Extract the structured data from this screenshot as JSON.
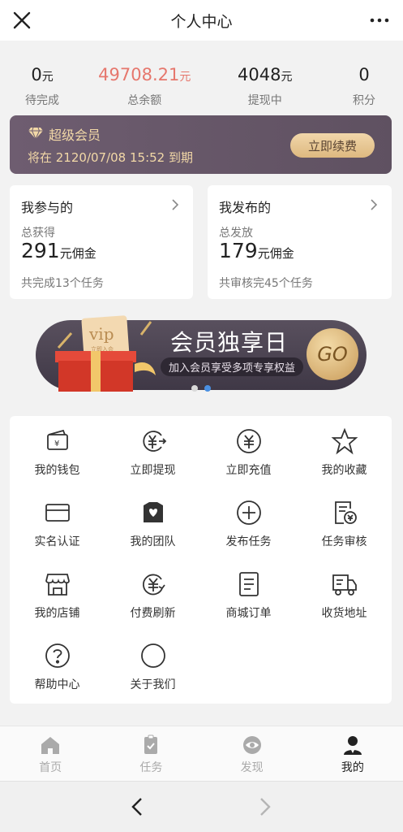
{
  "header": {
    "title": "个人中心",
    "close_icon": "close-icon",
    "more_icon": "more-icon"
  },
  "stats": [
    {
      "value": "0",
      "unit": "元",
      "label": "待完成"
    },
    {
      "value": "49708.21",
      "unit": "元",
      "label": "总余额",
      "color": "#e6776d"
    },
    {
      "value": "4048",
      "unit": "元",
      "label": "提现中"
    },
    {
      "value": "0",
      "unit": "",
      "label": "积分"
    }
  ],
  "vip": {
    "title": "超级会员",
    "expire_text": "将在 2120/07/08 15:52 到期",
    "renew_label": "立即续费",
    "icon": "diamond-icon"
  },
  "participated": {
    "title": "我参与的",
    "sub": "总获得",
    "amount": "291",
    "suffix": "元佣金",
    "footer": "共完成13个任务"
  },
  "published": {
    "title": "我发布的",
    "sub": "总发放",
    "amount": "179",
    "suffix": "元佣金",
    "footer": "共审核完45个任务"
  },
  "banner": {
    "vip_text": "vip",
    "vip_sub": "立即入会",
    "headline": "会员独享日",
    "tagline": "加入会员享受多项专享权益",
    "go_label": "GO"
  },
  "menu": [
    {
      "label": "我的钱包",
      "icon": "wallet-icon"
    },
    {
      "label": "立即提现",
      "icon": "withdraw-icon"
    },
    {
      "label": "立即充值",
      "icon": "recharge-icon"
    },
    {
      "label": "我的收藏",
      "icon": "star-icon"
    },
    {
      "label": "实名认证",
      "icon": "id-card-icon"
    },
    {
      "label": "我的团队",
      "icon": "team-icon"
    },
    {
      "label": "发布任务",
      "icon": "plus-circle-icon"
    },
    {
      "label": "任务审核",
      "icon": "audit-icon"
    },
    {
      "label": "我的店铺",
      "icon": "shop-icon"
    },
    {
      "label": "付费刷新",
      "icon": "refresh-pay-icon"
    },
    {
      "label": "商城订单",
      "icon": "order-icon"
    },
    {
      "label": "收货地址",
      "icon": "truck-icon"
    },
    {
      "label": "帮助中心",
      "icon": "help-icon"
    },
    {
      "label": "关于我们",
      "icon": "about-icon"
    }
  ],
  "tabs": [
    {
      "label": "首页",
      "icon": "home-icon"
    },
    {
      "label": "任务",
      "icon": "task-icon"
    },
    {
      "label": "发现",
      "icon": "eye-icon"
    },
    {
      "label": "我的",
      "icon": "user-icon",
      "active": true
    }
  ],
  "colors": {
    "accent_red": "#e6776d",
    "vip_gold": "#f2d8a7",
    "vip_bg": "#6e5d70",
    "dot_active": "#4a90e2"
  }
}
